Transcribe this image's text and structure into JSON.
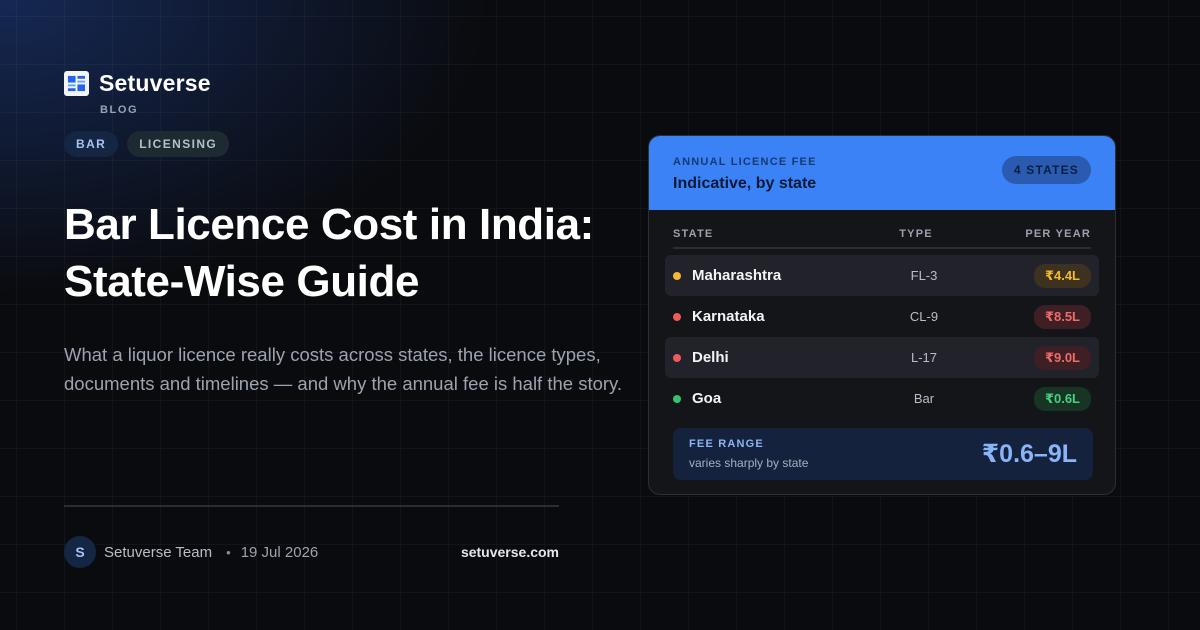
{
  "brand": {
    "name": "Setuverse",
    "sub": "BLOG"
  },
  "tags": [
    "BAR",
    "LICENSING"
  ],
  "article": {
    "title": "Bar Licence Cost in India: State-Wise Guide",
    "description": "What a liquor licence really costs across states, the licence types, documents and timelines — and why the annual fee is half the story.",
    "author_initial": "S",
    "author": "Setuverse Team",
    "separator": "•",
    "date": "19 Jul 2026",
    "site": "setuverse.com"
  },
  "card": {
    "kicker": "ANNUAL LICENCE FEE",
    "title": "Indicative, by state",
    "badge": "4 STATES",
    "columns": {
      "state": "STATE",
      "type": "TYPE",
      "fee": "PER YEAR"
    },
    "rows": [
      {
        "state": "Maharashtra",
        "type": "FL-3",
        "fee": "₹4.4L",
        "color": "#f5b82e",
        "fee_bg": "#3d3120",
        "fee_fg": "#f5b82e"
      },
      {
        "state": "Karnataka",
        "type": "CL-9",
        "fee": "₹8.5L",
        "color": "#ef5a5a",
        "fee_bg": "#3e1f24",
        "fee_fg": "#f06b6b"
      },
      {
        "state": "Delhi",
        "type": "L-17",
        "fee": "₹9.0L",
        "color": "#ef5a5a",
        "fee_bg": "#3e1f24",
        "fee_fg": "#f06b6b"
      },
      {
        "state": "Goa",
        "type": "Bar",
        "fee": "₹0.6L",
        "color": "#32c46c",
        "fee_bg": "#183524",
        "fee_fg": "#46d07f"
      }
    ],
    "range": {
      "label": "FEE RANGE",
      "sub": "varies sharply by state",
      "value": "₹0.6–9L"
    }
  }
}
